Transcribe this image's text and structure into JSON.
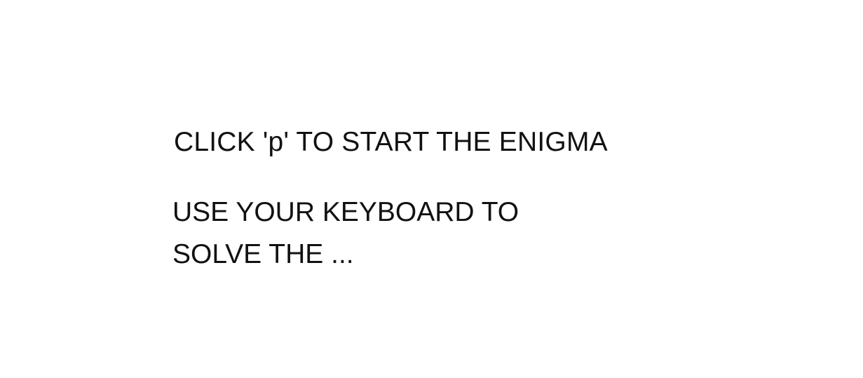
{
  "start_prompt": "CLICK 'p' TO START THE ENIGMA",
  "instructions": {
    "line1": "USE YOUR KEYBOARD TO",
    "line2": "SOLVE THE ..."
  }
}
